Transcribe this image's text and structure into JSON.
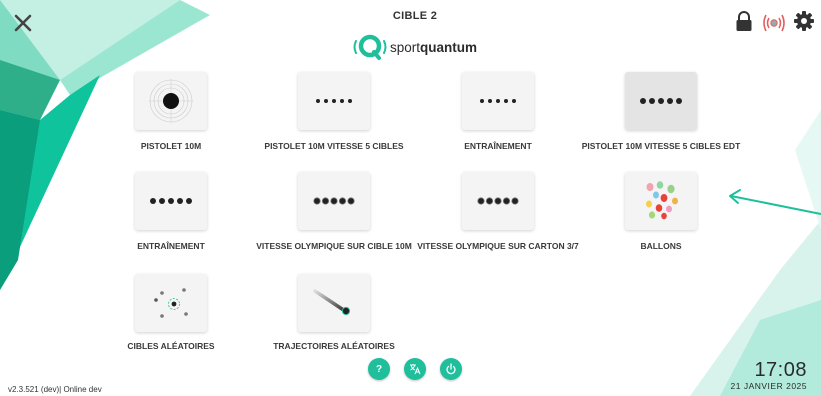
{
  "header": {
    "target_title": "CIBLE 2",
    "logo_text_light": "sport",
    "logo_text_bold": "quantum"
  },
  "icons": {
    "close": "close-icon",
    "lock": "lock-icon",
    "sensor": "wireless-sensor-icon",
    "settings": "gear-icon"
  },
  "modes": [
    {
      "label": "PISTOLET 10M",
      "icon": "pistol-target-icon"
    },
    {
      "label": "PISTOLET 10M VITESSE 5 CIBLES",
      "icon": "five-dots-icon"
    },
    {
      "label": "ENTRAÎNEMENT",
      "icon": "five-dots-icon"
    },
    {
      "label": "PISTOLET 10M VITESSE 5 CIBLES EDT",
      "icon": "five-big-dots-icon"
    },
    {
      "label": "ENTRAÎNEMENT",
      "icon": "five-big-dots-icon"
    },
    {
      "label": "VITESSE OLYMPIQUE SUR CIBLE 10M",
      "icon": "five-ringed-dots-icon"
    },
    {
      "label": "VITESSE OLYMPIQUE SUR CARTON 3/7",
      "icon": "five-ringed-dots-icon"
    },
    {
      "label": "BALLONS",
      "icon": "balloons-icon"
    },
    {
      "label": "CIBLES ALÉATOIRES",
      "icon": "random-targets-icon"
    },
    {
      "label": "TRAJECTOIRES ALÉATOIRES",
      "icon": "trajectory-icon"
    }
  ],
  "bottom_buttons": [
    {
      "label": "?",
      "icon": "help-icon"
    },
    {
      "label": "",
      "icon": "translate-icon"
    },
    {
      "label": "",
      "icon": "power-icon"
    }
  ],
  "footer": {
    "version": "v2.3.521 (dev)| Online dev",
    "time": "17:08",
    "date": "21 JANVIER 2025"
  },
  "colors": {
    "accent": "#1fbf9c",
    "accent_dark": "#0e9e80",
    "accent_light": "#8fe3cc"
  }
}
